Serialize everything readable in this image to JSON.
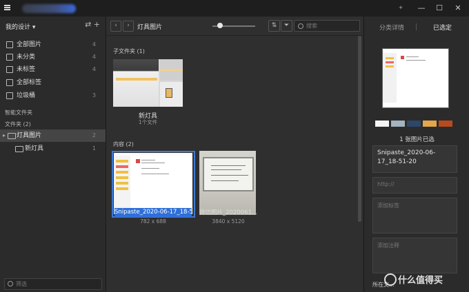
{
  "titlebar": {
    "controls": {
      "pin": "✦",
      "minimize": "—",
      "maximize": "☐",
      "close": "✕"
    }
  },
  "sidebar": {
    "header": "我的设计 ▾",
    "header_icons": "⇄  +",
    "items": [
      {
        "label": "全部图片",
        "count": "4",
        "icon": "images-icon"
      },
      {
        "label": "未分类",
        "count": "4",
        "icon": "unsorted-icon"
      },
      {
        "label": "未标签",
        "count": "4",
        "icon": "untagged-icon"
      },
      {
        "label": "全部标签",
        "count": "",
        "icon": "tags-icon"
      },
      {
        "label": "垃圾桶",
        "count": "3",
        "icon": "trash-icon"
      }
    ],
    "smart_folders": "智能文件夹",
    "folders_title": "文件夹 (2)",
    "tree": [
      {
        "label": "灯具图片",
        "count": "2",
        "active": true
      },
      {
        "label": "新灯具",
        "count": "1",
        "active": false
      }
    ],
    "filter_placeholder": "筛选"
  },
  "toolbar": {
    "back": "‹",
    "forward": "›",
    "breadcrumb": "灯具图片",
    "sort_icon": "⇅",
    "filter_icon": "⏷",
    "search_placeholder": "搜索"
  },
  "content": {
    "subfolders_title": "子文件夹 (1)",
    "subfolder": {
      "name": "新灯具",
      "meta": "1个文件"
    },
    "items_title": "内容 (2)",
    "items": [
      {
        "name": "Snipaste_2020-06-17_18-5...",
        "dims": "782 x 688",
        "selected": true
      },
      {
        "name": "微信图片_2020061...",
        "dims": "3840 x 5120",
        "selected": false
      }
    ]
  },
  "rpanel": {
    "tab_details": "分类详情",
    "tab_selected": "已选定",
    "palette": [
      "#f4f4f4",
      "#a3b3bf",
      "#2e4668",
      "#e3a64a",
      "#b84a1e"
    ],
    "count": "1 张图片已选",
    "filename": "Snipaste_2020-06-17_18-51-20",
    "url_placeholder": "http://",
    "tags_placeholder": "添加标签",
    "notes_placeholder": "添加注释",
    "footer": "所在文..."
  },
  "watermark": "什么值得买"
}
